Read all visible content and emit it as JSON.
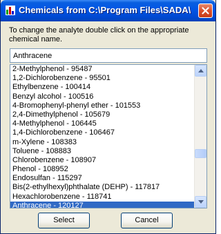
{
  "window": {
    "title": "Chemicals from C:\\Program Files\\SADA\\..."
  },
  "instruction": "To change the analyte double click on the appropriate chemical name.",
  "analyte_input": {
    "value": "Anthracene"
  },
  "chemicals": [
    "2-Methylphenol  -  95487",
    "1,2-Dichlorobenzene  -  95501",
    "Ethylbenzene  -  100414",
    "Benzyl alcohol  -  100516",
    "4-Bromophenyl-phenyl ether  -  101553",
    "2,4-Dimethylphenol  -  105679",
    "4-Methylphenol  -  106445",
    "1,4-Dichlorobenzene  -  106467",
    "m-Xylene  -  108383",
    "Toluene  -  108883",
    "Chlorobenzene  -  108907",
    "Phenol  -  108952",
    "Endosulfan  -  115297",
    "Bis(2-ethylhexyl)phthalate (DEHP)  -  117817",
    "Hexachlorobenzene  -  118741",
    "Anthracene  -  120127"
  ],
  "selected_index": 15,
  "buttons": {
    "select": "Select",
    "cancel": "Cancel"
  },
  "icons": {
    "app": "chart-icon",
    "close": "close-icon",
    "scroll_up": "arrow-up-icon",
    "scroll_down": "arrow-down-icon"
  },
  "colors": {
    "titlebar": "#0055e5",
    "selection": "#316ac5",
    "close": "#d9502c"
  }
}
